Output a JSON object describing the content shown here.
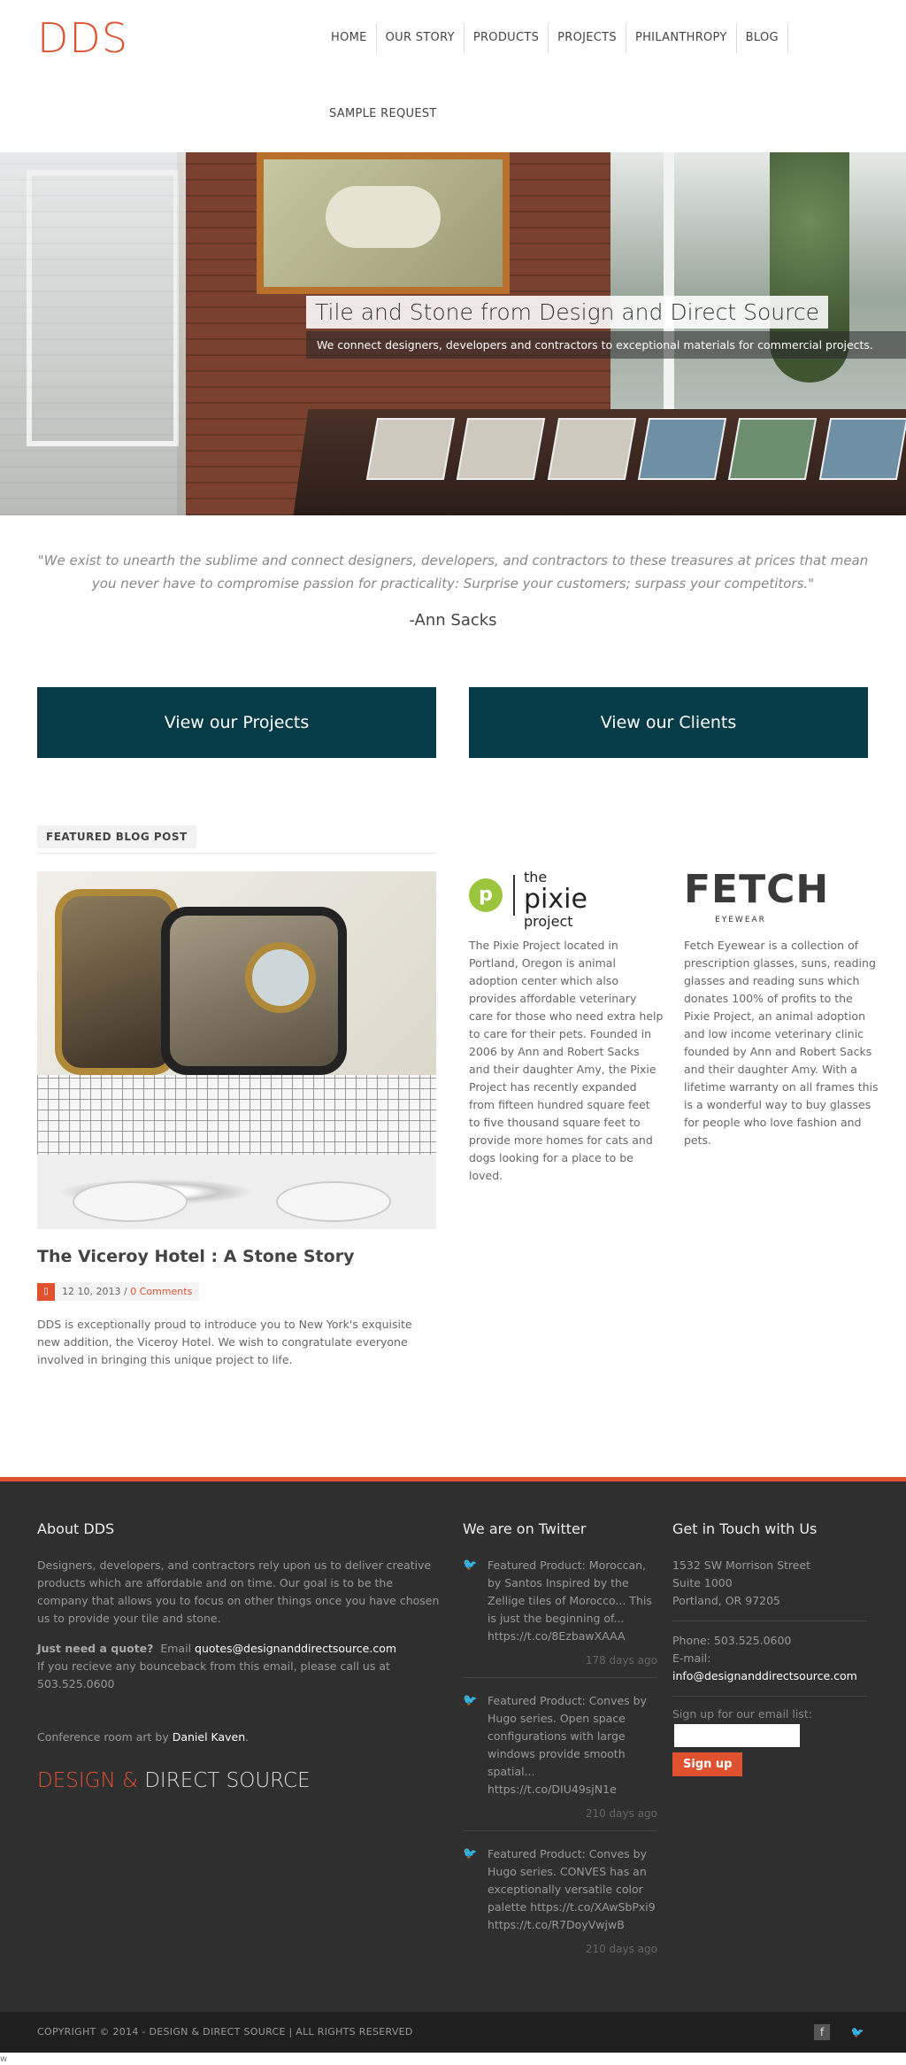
{
  "header": {
    "logo": "DDS",
    "nav": [
      "HOME",
      "OUR STORY",
      "PRODUCTS",
      "PROJECTS",
      "PHILANTHROPY",
      "BLOG"
    ],
    "nav_row2": "SAMPLE REQUEST"
  },
  "hero": {
    "title": "Tile and Stone from Design and Direct Source",
    "subtitle": "We connect designers, developers and contractors to exceptional materials for commercial projects."
  },
  "quote": {
    "text": "\"We exist to unearth the sublime and connect designers, developers, and contractors to these treasures at prices that mean you never have to compromise passion for practicality: Surprise your customers; surpass your competitors.\"",
    "author": "-Ann Sacks"
  },
  "cta": {
    "projects": "View our Projects",
    "clients": "View our Clients"
  },
  "featured": {
    "label": "FEATURED BLOG POST",
    "title": "The Viceroy Hotel : A Stone Story",
    "date": "12 10, 2013 /",
    "comments": "0 Comments",
    "excerpt": "DDS is exceptionally proud to introduce you to New York's exquisite new addition, the Viceroy Hotel. We wish to congratulate everyone involved in bringing this unique project to life."
  },
  "partners": {
    "pixie": {
      "logo_letter": "p",
      "logo_the": "the",
      "logo_pixie": "pixie",
      "logo_project": "project",
      "text": "The Pixie Project located in Portland, Oregon is animal adoption center which also provides affordable veterinary care for those who need extra help to care for their pets. Founded in 2006 by Ann and Robert Sacks and their daughter Amy, the Pixie Project has recently expanded from fifteen hundred square feet to five thousand square feet to provide more homes for cats and dogs looking for a place to be loved."
    },
    "fetch": {
      "logo": "FETCH",
      "logo_sub": "EYEWEAR",
      "text": "Fetch Eyewear is a collection of prescription glasses, suns, reading glasses and reading suns which donates 100% of profits to the Pixie Project, an animal adoption and low income veterinary clinic founded by Ann and Robert Sacks and their daughter Amy. With a lifetime warranty on all frames this is a wonderful way to buy glasses for people who love fashion and pets."
    }
  },
  "footer": {
    "about": {
      "heading": "About DDS",
      "text": "Designers, developers, and contractors rely upon us to deliver creative products which are affordable and on time. Our goal is to be the company that allows you to focus on other things once you have chosen us to provide your tile and stone.",
      "quote_label": "Just need a quote?",
      "email_label": "Email",
      "email": "quotes@designanddirectsource.com",
      "bounce": "If you recieve any bounceback from this email, please call us at 503.525.0600",
      "art_prefix": "Conference room art by",
      "art_name": "Daniel Kaven",
      "art_suffix": ".",
      "brand_a": "DESIGN &",
      "brand_b": "DIRECT SOURCE"
    },
    "twitter": {
      "heading": "We are on Twitter",
      "tweets": [
        {
          "text": "Featured Product: Moroccan, by Santos Inspired by the Zellige tiles of Morocco... This is just the beginning of... https://t.co/8EzbawXAAA",
          "ago": "178 days ago"
        },
        {
          "text": "Featured Product: Conves by Hugo series. Open space configurations with large windows provide smooth spatial... https://t.co/DIU49sjN1e",
          "ago": "210 days ago"
        },
        {
          "text": "Featured Product: Conves by Hugo series. CONVES has an exceptionally versatile color palette https://t.co/XAwSbPxi9 https://t.co/R7DoyVwjwB",
          "ago": "210 days ago"
        }
      ]
    },
    "contact": {
      "heading": "Get in Touch with Us",
      "address1": "1532 SW Morrison Street",
      "address2": "Suite 1000",
      "address3": "Portland, OR 97205",
      "phone": "Phone: 503.525.0600",
      "email_label": "E-mail:",
      "email": "info@designanddirectsource.com",
      "signup_label": "Sign up for our email list:",
      "signup_button": "Sign up"
    },
    "copyright": "COPYRIGHT © 2014 - DESIGN & DIRECT SOURCE | ALL RIGHTS RESERVED",
    "stray": "w"
  },
  "colors": {
    "accent": "#e0512f",
    "cta": "#063c48",
    "footer": "#2f2f2f"
  }
}
